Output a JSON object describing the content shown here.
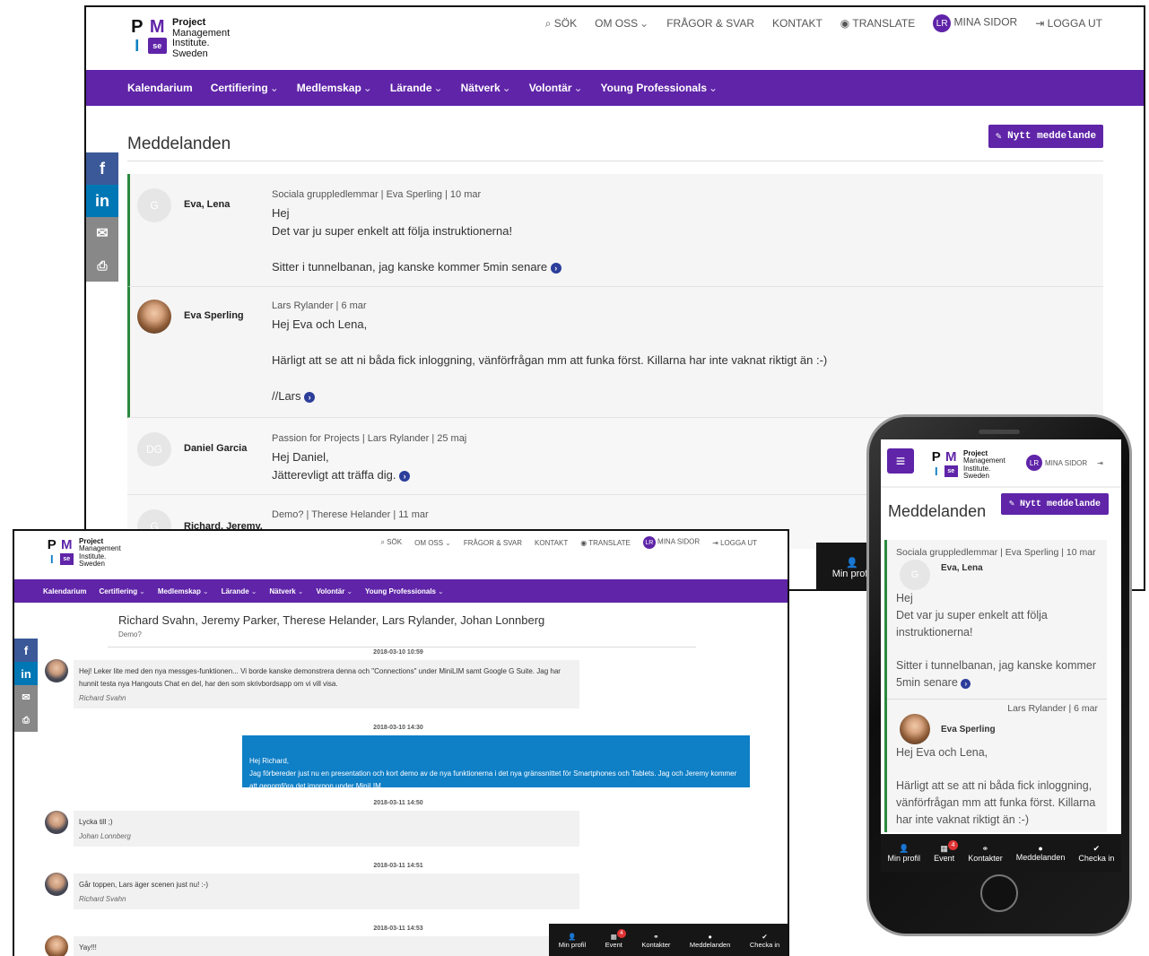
{
  "brand": {
    "letters": [
      "P",
      "M",
      "I",
      "se"
    ],
    "lines": [
      "Project",
      "Management",
      "Institute.",
      "Sweden"
    ]
  },
  "topnav": {
    "search": "SÖK",
    "about": "OM OSS",
    "faq": "FRÅGOR & SVAR",
    "contact": "KONTAKT",
    "translate": "TRANSLATE",
    "initials": "LR",
    "mypages": "MINA SIDOR",
    "logout": "LOGGA UT"
  },
  "mainnav": [
    "Kalendarium",
    "Certifiering",
    "Medlemskap",
    "Lärande",
    "Nätverk",
    "Volontär",
    "Young Professionals"
  ],
  "desktop": {
    "title": "Meddelanden",
    "new_button": "Nytt meddelande",
    "messages": [
      {
        "initial": "G",
        "name": "Eva, Lena",
        "meta": "Sociala gruppledlemmar | Eva Sperling | 10 mar",
        "lines": [
          "Hej",
          "Det var ju super enkelt att följa instruktionerna!",
          "",
          "Sitter i tunnelbanan, jag kanske kommer 5min senare"
        ]
      },
      {
        "initial": "",
        "name": "Eva Sperling",
        "meta": "Lars Rylander | 6 mar",
        "lines": [
          "Hej Eva och Lena,",
          "",
          "Härligt att se att ni båda fick inloggning, vänförfrågan mm att funka först. Killarna har inte vaknat riktigt än :-)",
          "",
          "//Lars"
        ]
      },
      {
        "initial": "DG",
        "name": "Daniel Garcia",
        "meta": "Passion for Projects | Lars Rylander | 25 maj",
        "lines": [
          "Hej Daniel,",
          "Jätterevligt att träffa dig."
        ]
      },
      {
        "initial": "G",
        "name": "Richard, Jeremy, Therese, Johan",
        "meta": "Demo? | Therese Helander | 11 mar",
        "lines": []
      }
    ],
    "bottom_partial": "Min profil"
  },
  "chat": {
    "participants": "Richard Svahn, Jeremy Parker, Therese Helander, Lars Rylander, Johan Lonnberg",
    "subject": "Demo?",
    "entries": [
      {
        "ts": "2018-03-10 10:59",
        "text": "Hej! Leker lite med den nya messges-funktionen... Vi borde kanske demonstrera denna och \"Connections\" under MiniLIM samt Google G Suite. Jag har hunnit testa nya Hangouts Chat en del, har den som skrivbordsapp om vi vill visa.",
        "author": "Richard Svahn"
      },
      {
        "ts": "2018-03-10 14:30",
        "text": "Hej Richard,\nJag förbereder just nu en presentation och kort demo av de nya funktionerna i det nya gränssnittet för Smartphones och Tablets. Jag och Jeremy kommer att genomföra det imorgon under MiniLIM.",
        "author": ""
      },
      {
        "ts": "2018-03-11 14:50",
        "text": "Lycka till ;)",
        "author": "Johan Lonnberg"
      },
      {
        "ts": "2018-03-11 14:51",
        "text": "Går toppen, Lars äger scenen just nu! :-)",
        "author": "Richard Svahn"
      },
      {
        "ts": "2018-03-11 14:53",
        "text": "Yay!!!",
        "author": ""
      }
    ]
  },
  "bottombar": {
    "items": [
      "Min profil",
      "Event",
      "Kontakter",
      "Meddelanden",
      "Checka in"
    ],
    "badge": "4"
  },
  "phone": {
    "mypages": "MINA SIDOR",
    "title": "Meddelanden",
    "new_button": "Nytt meddelande",
    "msg1": {
      "meta": "Sociala gruppledlemmar | Eva Sperling | 10 mar",
      "name": "Eva, Lena",
      "initial": "G",
      "lines": [
        "Hej",
        "Det var ju super enkelt att följa instruktionerna!",
        "Sitter i tunnelbanan, jag kanske kommer 5min senare"
      ]
    },
    "msg2": {
      "meta": "Lars Rylander | 6 mar",
      "name": "Eva Sperling",
      "lines": [
        "Hej Eva och Lena,",
        "Härligt att se att ni båda fick inloggning, vänförfrågan mm att funka först. Killarna har inte vaknat riktigt än :-)"
      ]
    }
  },
  "colors": {
    "brand": "#5f24a8",
    "blue": "#0f7fc6",
    "facebook": "#3b5998",
    "linkedin": "#0077b5"
  }
}
